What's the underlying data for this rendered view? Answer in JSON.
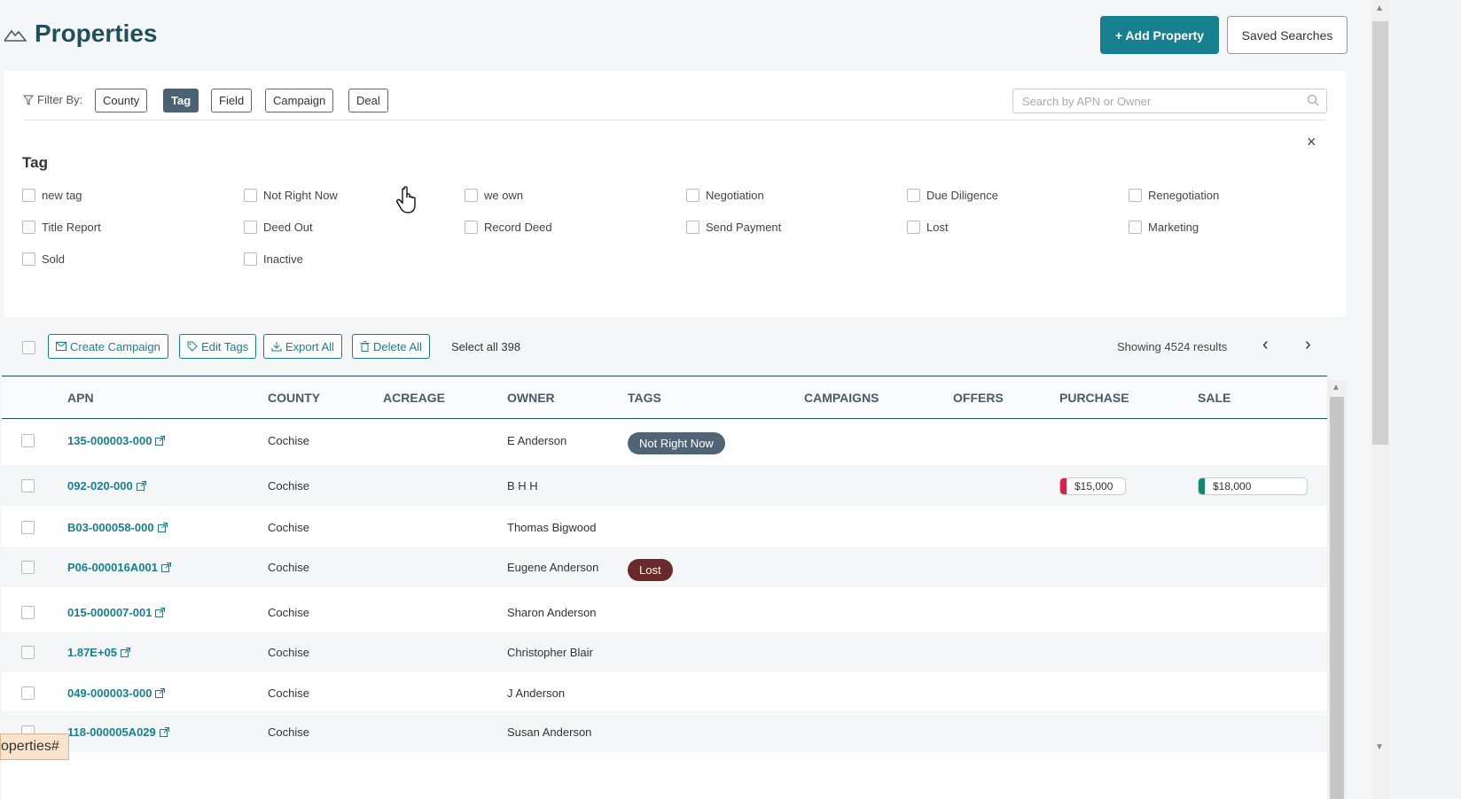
{
  "header": {
    "title": "Properties",
    "add_property_label": "+ Add Property",
    "saved_searches_label": "Saved Searches"
  },
  "filters": {
    "label": "Filter By:",
    "chips": [
      "County",
      "Tag",
      "Field",
      "Campaign",
      "Deal"
    ],
    "active_chip": "Tag",
    "search_placeholder": "Search by APN or Owner",
    "close": "×"
  },
  "tag_panel": {
    "heading": "Tag",
    "options": [
      "new tag",
      "Not Right Now",
      "we own",
      "Negotiation",
      "Due Diligence",
      "Renegotiation",
      "Title Report",
      "Deed Out",
      "Record Deed",
      "Send Payment",
      "Lost",
      "Marketing",
      "Sold",
      "Inactive"
    ]
  },
  "toolbar": {
    "create_campaign": "Create Campaign",
    "edit_tags": "Edit Tags",
    "export_all": "Export All",
    "delete_all": "Delete All",
    "select_all": "Select all 398",
    "showing": "Showing 4524 results",
    "prev": "‹",
    "next": "›"
  },
  "table": {
    "columns": [
      "APN",
      "COUNTY",
      "ACREAGE",
      "OWNER",
      "TAGS",
      "CAMPAIGNS",
      "OFFERS",
      "PURCHASE",
      "SALE"
    ],
    "rows": [
      {
        "apn": "135-000003-000",
        "county": "Cochise",
        "owner": "E Anderson",
        "tag": "Not Right Now",
        "purchase": "",
        "sale": ""
      },
      {
        "apn": "092-020-000",
        "county": "Cochise",
        "owner": "B H H",
        "tag": "",
        "purchase": "$15,000",
        "sale": "$18,000"
      },
      {
        "apn": "B03-000058-000",
        "county": "Cochise",
        "owner": "Thomas Bigwood",
        "tag": "",
        "purchase": "",
        "sale": ""
      },
      {
        "apn": "P06-000016A001",
        "county": "Cochise",
        "owner": "Eugene Anderson",
        "tag": "Lost",
        "purchase": "",
        "sale": ""
      },
      {
        "apn": "015-000007-001",
        "county": "Cochise",
        "owner": "Sharon Anderson",
        "tag": "",
        "purchase": "",
        "sale": ""
      },
      {
        "apn": "1.87E+05",
        "county": "Cochise",
        "owner": "Christopher Blair",
        "tag": "",
        "purchase": "",
        "sale": ""
      },
      {
        "apn": "049-000003-000",
        "county": "Cochise",
        "owner": "J Anderson",
        "tag": "",
        "purchase": "",
        "sale": ""
      },
      {
        "apn": "118-000005A029",
        "county": "Cochise",
        "owner": "Susan Anderson",
        "tag": "",
        "purchase": "",
        "sale": ""
      }
    ]
  },
  "tag_colors": {
    "Not Right Now": "#4f6577",
    "Lost": "#6b2a2a"
  },
  "money_colors": {
    "purchase": "#d6224a",
    "sale": "#138a6d"
  },
  "status_bar": "operties#",
  "colors": {
    "accent": "#17808f",
    "title": "#1f4f5a"
  }
}
